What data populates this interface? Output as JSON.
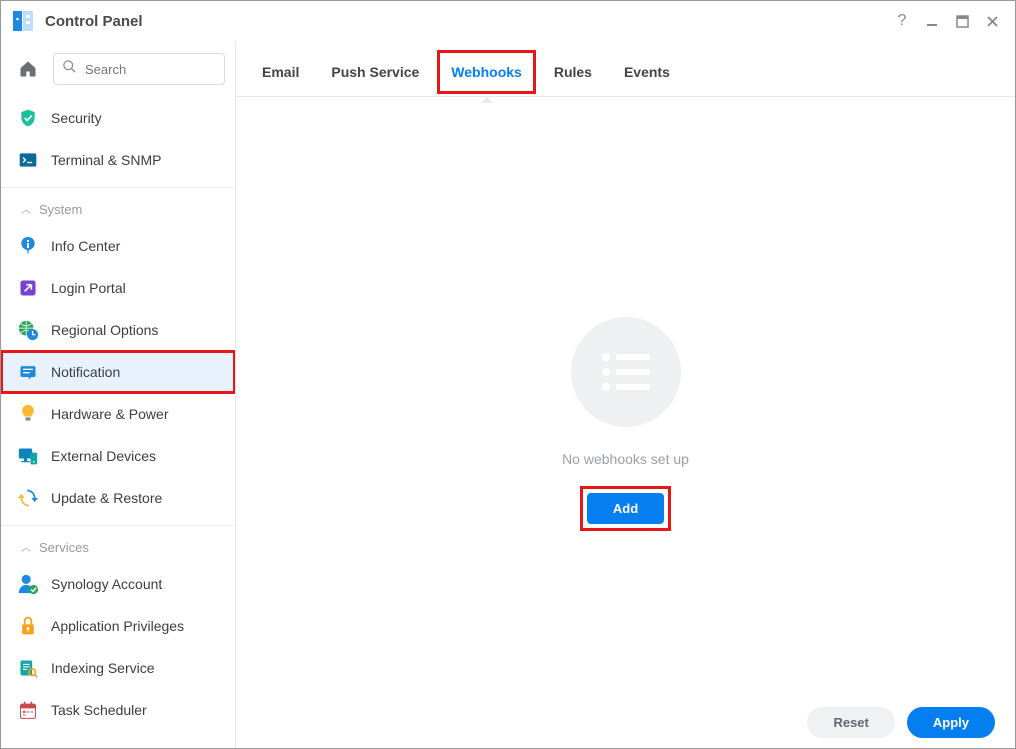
{
  "window": {
    "title": "Control Panel"
  },
  "search": {
    "placeholder": "Search"
  },
  "sidebar": {
    "top_items": [
      {
        "label": "Security"
      },
      {
        "label": "Terminal & SNMP"
      }
    ],
    "groups": [
      {
        "header": "System",
        "items": [
          {
            "label": "Info Center"
          },
          {
            "label": "Login Portal"
          },
          {
            "label": "Regional Options"
          },
          {
            "label": "Notification",
            "active": true
          },
          {
            "label": "Hardware & Power"
          },
          {
            "label": "External Devices"
          },
          {
            "label": "Update & Restore"
          }
        ]
      },
      {
        "header": "Services",
        "items": [
          {
            "label": "Synology Account"
          },
          {
            "label": "Application Privileges"
          },
          {
            "label": "Indexing Service"
          },
          {
            "label": "Task Scheduler"
          }
        ]
      }
    ]
  },
  "tabs": {
    "items": [
      "Email",
      "Push Service",
      "Webhooks",
      "Rules",
      "Events"
    ],
    "active": "Webhooks"
  },
  "main": {
    "empty_message": "No webhooks set up",
    "add_button": "Add"
  },
  "footer": {
    "reset": "Reset",
    "apply": "Apply"
  }
}
